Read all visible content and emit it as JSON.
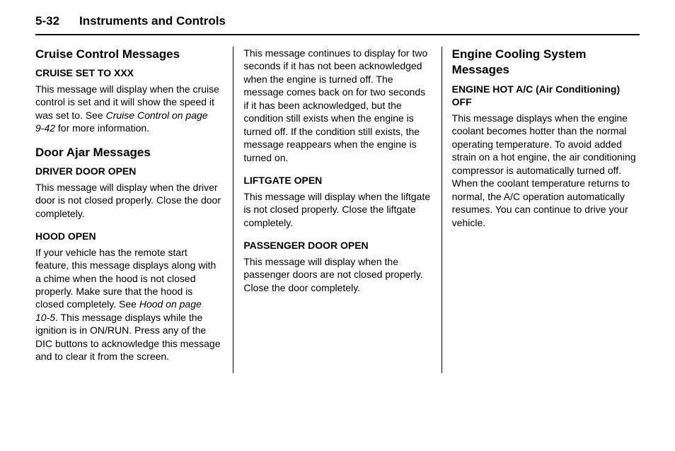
{
  "header": {
    "page_num": "5-32",
    "title": "Instruments and Controls"
  },
  "col1": {
    "heading1": "Cruise Control Messages",
    "sub1": "CRUISE SET TO XXX",
    "para1a": "This message will display when the cruise control is set and it will show the speed it was set to. See ",
    "para1b_italic": "Cruise Control on page 9‑42",
    "para1c": " for more information.",
    "heading2": "Door Ajar Messages",
    "sub2": "DRIVER DOOR OPEN",
    "para2": "This message will display when the driver door is not closed properly. Close the door completely.",
    "sub3": "HOOD OPEN",
    "para3a": "If your vehicle has the remote start feature, this message displays along with a chime when the hood is not closed properly. Make sure that the hood is closed completely. See ",
    "para3b_italic": "Hood on page 10‑5",
    "para3c": ". This message displays while the ignition is in ON/RUN. Press any of the DIC buttons to acknowledge this message and to clear it from the screen."
  },
  "col2": {
    "para1": "This message continues to display for two seconds if it has not been acknowledged when the engine is turned off. The message comes back on for two seconds if it has been acknowledged, but the condition still exists when the engine is turned off. If the condition still exists, the message reappears when the engine is turned on.",
    "sub1": "LIFTGATE OPEN",
    "para2": "This message will display when the liftgate is not closed properly. Close the liftgate completely.",
    "sub2": "PASSENGER DOOR OPEN",
    "para3": "This message will display when the passenger doors are not closed properly. Close the door completely."
  },
  "col3": {
    "heading1": "Engine Cooling System Messages",
    "sub1": "ENGINE HOT A/C (Air Conditioning) OFF",
    "para1": "This message displays when the engine coolant becomes hotter than the normal operating temperature. To avoid added strain on a hot engine, the air conditioning compressor is automatically turned off. When the coolant temperature returns to normal, the A/C operation automatically resumes. You can continue to drive your vehicle."
  }
}
